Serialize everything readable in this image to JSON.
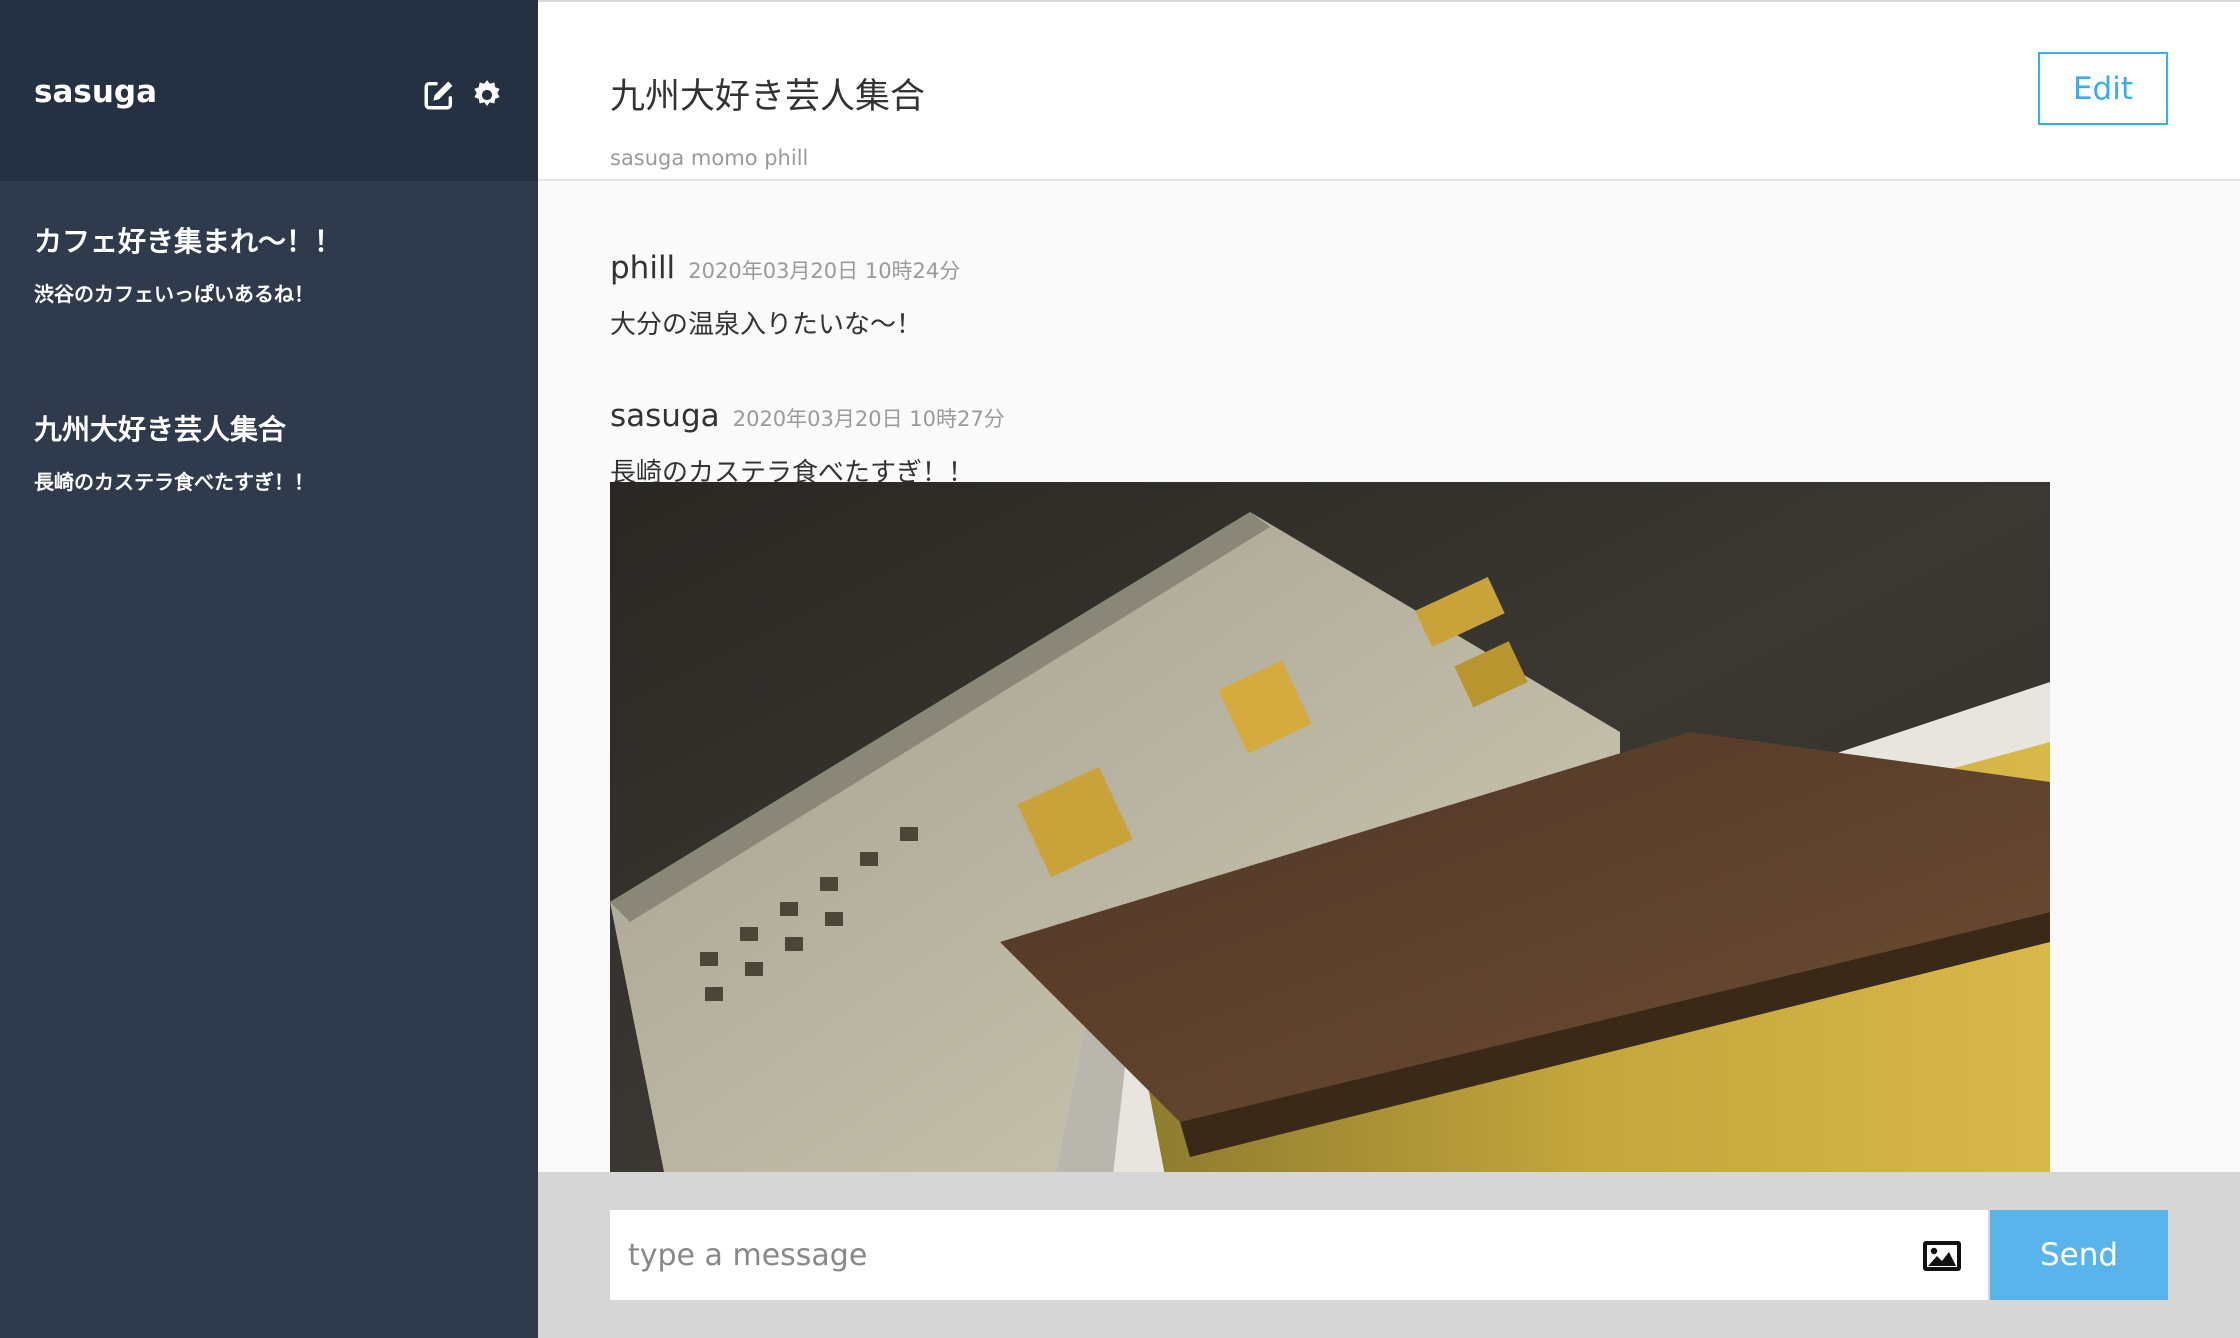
{
  "sidebar": {
    "user_name": "sasuga",
    "groups": [
      {
        "name": "カフェ好き集まれ〜！！",
        "last_message": "渋谷のカフェいっぱいあるね！"
      },
      {
        "name": "九州大好き芸人集合",
        "last_message": "長崎のカステラ食べたすぎ！！"
      }
    ]
  },
  "header": {
    "title": "九州大好き芸人集合",
    "members": "sasuga momo phill",
    "edit_label": "Edit"
  },
  "messages": [
    {
      "user": "phill",
      "date": "2020年03月20日 10時24分",
      "text": "大分の温泉入りたいな〜！"
    },
    {
      "user": "sasuga",
      "date": "2020年03月20日 10時27分",
      "text": "長崎のカステラ食べたすぎ！！"
    }
  ],
  "form": {
    "placeholder": "type a message",
    "send_label": "Send"
  },
  "icons": {
    "edit": "pencil-square-icon",
    "settings": "gear-icon",
    "image_upload": "image-icon"
  },
  "colors": {
    "sidebar_header": "#253142",
    "sidebar_body": "#2f3a4c",
    "accent": "#38aef0",
    "send_button": "#5ab4ec"
  }
}
